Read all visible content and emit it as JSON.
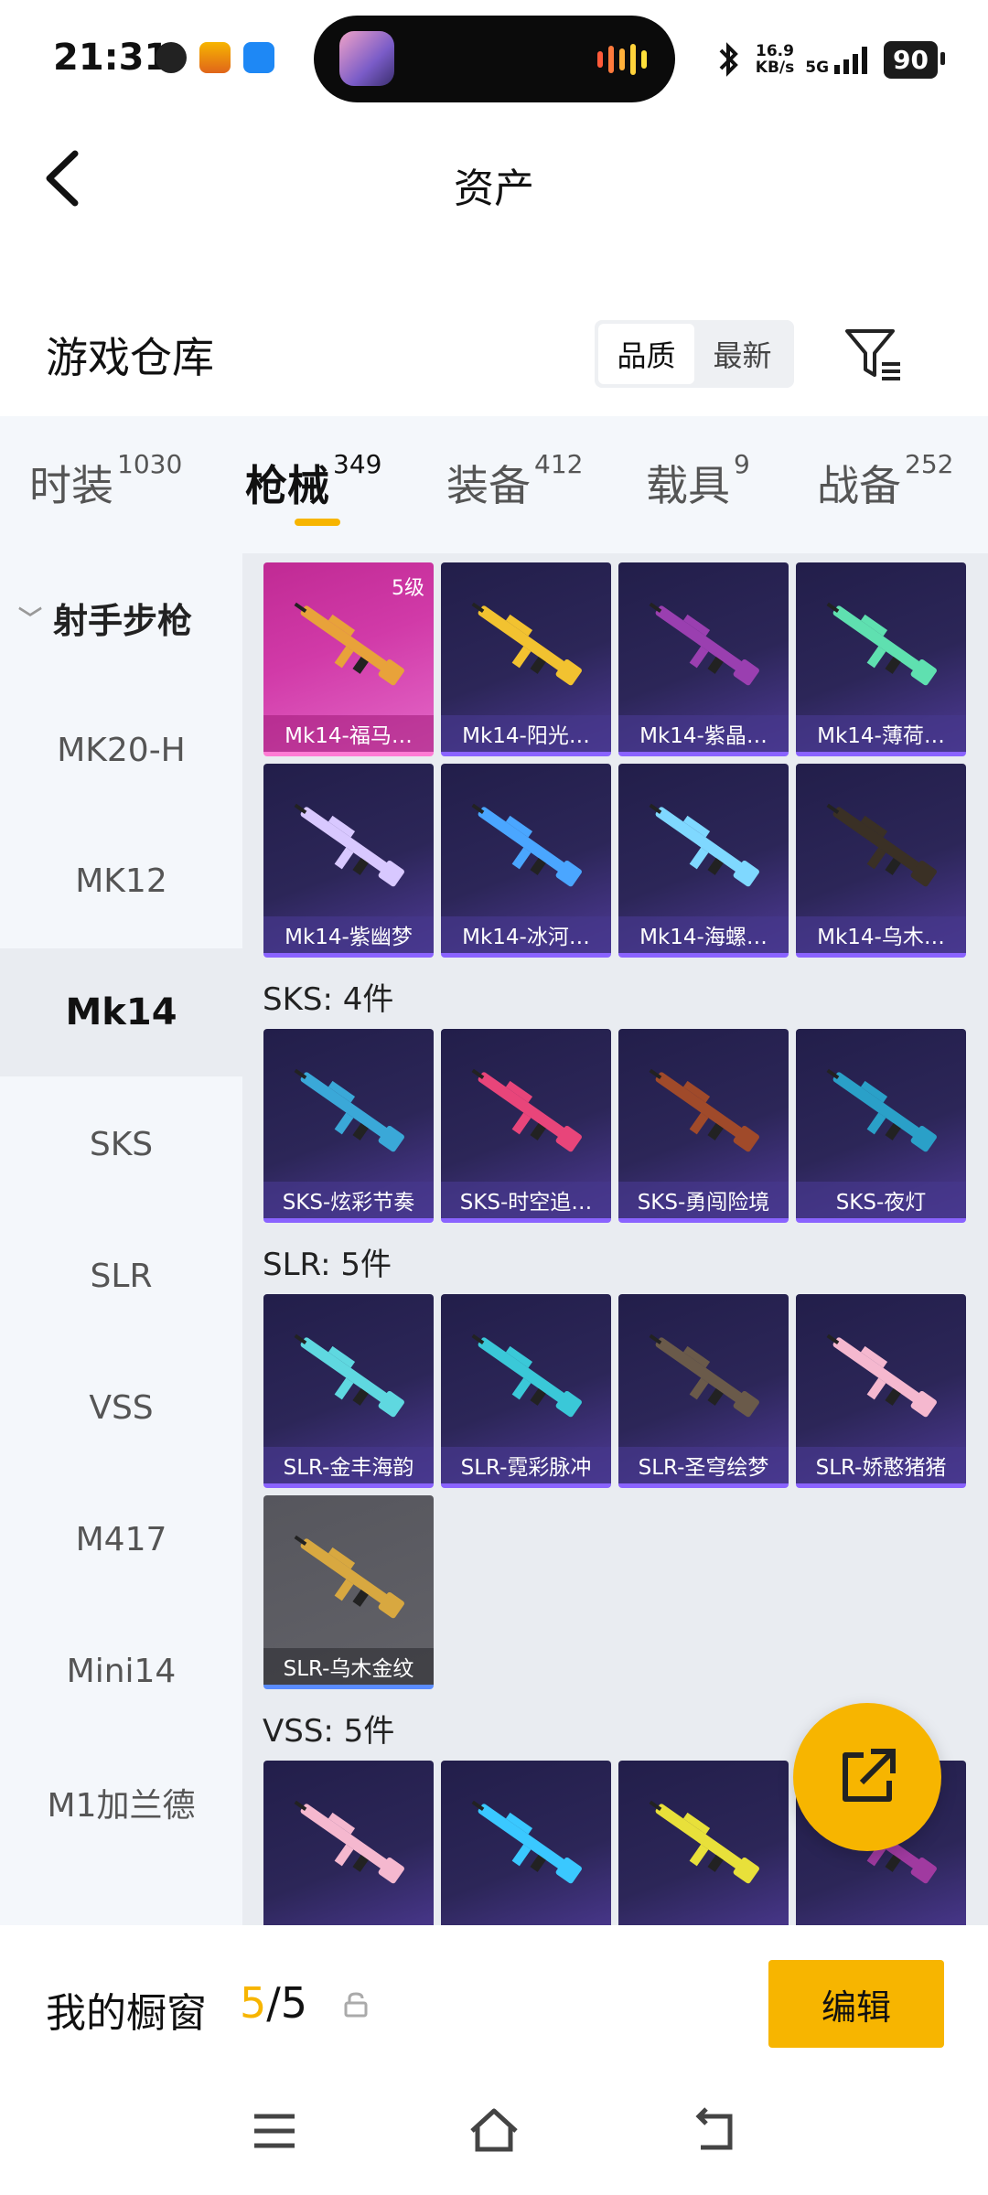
{
  "status_bar": {
    "time": "21:31",
    "speed_value": "16.9",
    "speed_unit": "KB/s",
    "network": "5G",
    "battery": "90"
  },
  "header": {
    "title": "资产"
  },
  "warehouse": {
    "title": "游戏仓库",
    "sort_options": [
      "品质",
      "最新"
    ],
    "active_sort": "品质"
  },
  "categories": [
    {
      "label": "时装",
      "count": "1030"
    },
    {
      "label": "枪械",
      "count": "349"
    },
    {
      "label": "装备",
      "count": "412"
    },
    {
      "label": "载具",
      "count": "9"
    },
    {
      "label": "战备",
      "count": "252"
    }
  ],
  "active_category": "枪械",
  "sidebar": {
    "group": "射手步枪",
    "items": [
      "MK20-H",
      "MK12",
      "Mk14",
      "SKS",
      "SLR",
      "VSS",
      "M417",
      "Mini14",
      "M1加兰德"
    ],
    "active": "Mk14"
  },
  "sections": [
    {
      "title": "",
      "cards": [
        {
          "label": "Mk14-福马…",
          "level": "5级",
          "style": "gold",
          "gun": "#e8a23a"
        },
        {
          "label": "Mk14-阳光…",
          "style": "purple",
          "gun": "#f2c230"
        },
        {
          "label": "Mk14-紫晶…",
          "style": "purple",
          "gun": "#9a3fb0"
        },
        {
          "label": "Mk14-薄荷…",
          "style": "purple",
          "gun": "#5fe0b0"
        },
        {
          "label": "Mk14-紫幽梦",
          "style": "purple",
          "gun": "#d8c8ff"
        },
        {
          "label": "Mk14-冰河…",
          "style": "purple",
          "gun": "#4aa6ff"
        },
        {
          "label": "Mk14-海螺…",
          "style": "purple",
          "gun": "#7fd8ff"
        },
        {
          "label": "Mk14-乌木…",
          "style": "purple",
          "gun": "#3a3025"
        }
      ]
    },
    {
      "title": "SKS: 4件",
      "cards": [
        {
          "label": "SKS-炫彩节奏",
          "style": "purple",
          "gun": "#3aa8d8"
        },
        {
          "label": "SKS-时空追…",
          "style": "purple",
          "gun": "#e8457a"
        },
        {
          "label": "SKS-勇闯险境",
          "style": "purple",
          "gun": "#a04a2a"
        },
        {
          "label": "SKS-夜灯",
          "style": "purple",
          "gun": "#2aa0c8"
        }
      ]
    },
    {
      "title": "SLR: 5件",
      "cards": [
        {
          "label": "SLR-金丰海韵",
          "style": "purple",
          "gun": "#5fd8e0"
        },
        {
          "label": "SLR-霓彩脉冲",
          "style": "purple",
          "gun": "#3ac8d8"
        },
        {
          "label": "SLR-圣穹绘梦",
          "style": "purple",
          "gun": "#6a5a4a"
        },
        {
          "label": "SLR-娇憨猪猪",
          "style": "purple",
          "gun": "#f5b8cf"
        },
        {
          "label": "SLR-乌木金纹",
          "style": "grey",
          "gun": "#d8a840"
        }
      ]
    },
    {
      "title": "VSS: 5件",
      "cards": [
        {
          "label": "",
          "style": "purple",
          "gun": "#f5b8cf"
        },
        {
          "label": "",
          "style": "purple",
          "gun": "#3ac8ff"
        },
        {
          "label": "",
          "style": "purple",
          "gun": "#e8e03a"
        },
        {
          "label": "",
          "style": "purple",
          "gun": "#a03aa0"
        }
      ]
    }
  ],
  "showcase": {
    "label": "我的橱窗",
    "current": "5",
    "separator": "/",
    "total": "5",
    "edit_label": "编辑"
  },
  "colors": {
    "accent": "#f7b500",
    "card_purple": "#2c2658",
    "card_gold": "#d13aa8",
    "card_grey": "#626268"
  }
}
